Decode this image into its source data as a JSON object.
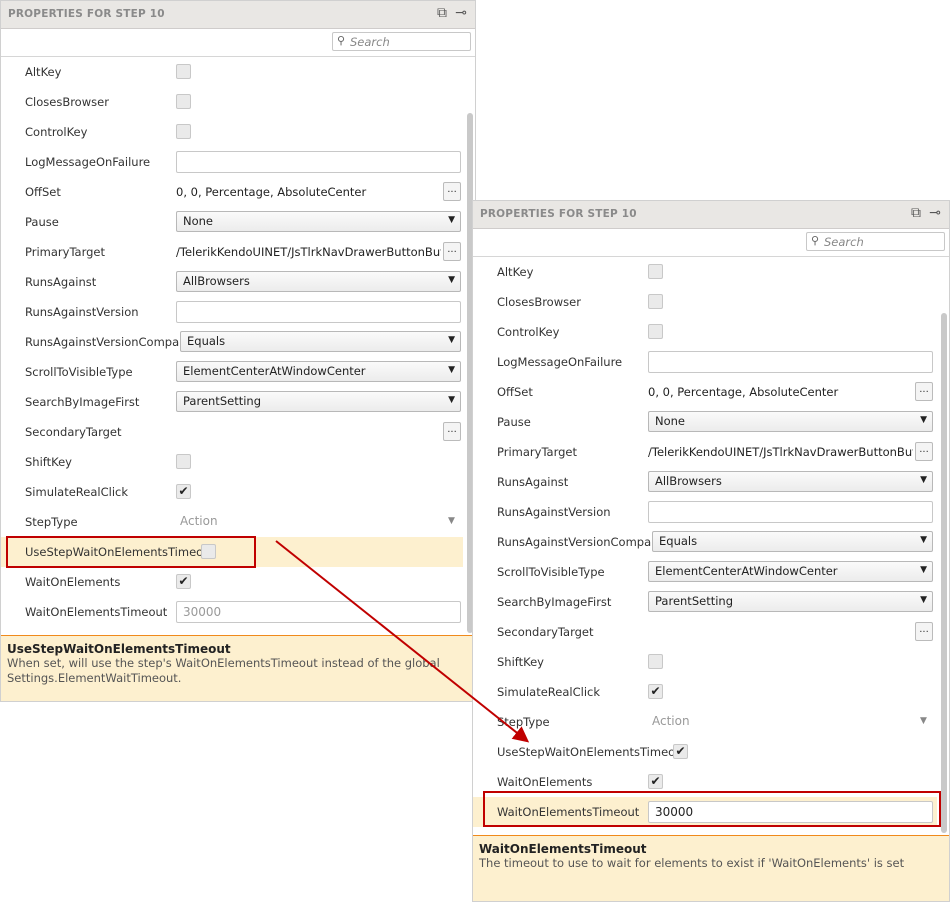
{
  "panels": [
    {
      "title": "PROPERTIES FOR STEP 10",
      "search_placeholder": "Search",
      "icons": [
        "pop-out-icon",
        "pin-icon"
      ],
      "rows": [
        {
          "label": "AltKey",
          "type": "checkbox",
          "checked": false
        },
        {
          "label": "ClosesBrowser",
          "type": "checkbox",
          "checked": false
        },
        {
          "label": "ControlKey",
          "type": "checkbox",
          "checked": false
        },
        {
          "label": "LogMessageOnFailure",
          "type": "text",
          "value": ""
        },
        {
          "label": "OffSet",
          "type": "value-ellipsis",
          "value": "0, 0, Percentage, AbsoluteCenter",
          "button": "..."
        },
        {
          "label": "Pause",
          "type": "select",
          "value": "None"
        },
        {
          "label": "PrimaryTarget",
          "type": "value-ellipsis",
          "value": "/TelerikKendoUINET/JsTlrkNavDrawerButtonButto",
          "button": "..."
        },
        {
          "label": "RunsAgainst",
          "type": "select",
          "value": "AllBrowsers"
        },
        {
          "label": "RunsAgainstVersion",
          "type": "text",
          "value": ""
        },
        {
          "label": "RunsAgainstVersionCompare",
          "type": "select",
          "value": "Equals"
        },
        {
          "label": "ScrollToVisibleType",
          "type": "select",
          "value": "ElementCenterAtWindowCenter"
        },
        {
          "label": "SearchByImageFirst",
          "type": "select",
          "value": "ParentSetting"
        },
        {
          "label": "SecondaryTarget",
          "type": "ellipsis",
          "button": "..."
        },
        {
          "label": "ShiftKey",
          "type": "checkbox",
          "checked": false
        },
        {
          "label": "SimulateRealClick",
          "type": "checkbox",
          "checked": true
        },
        {
          "label": "StepType",
          "type": "readonly",
          "value": "Action"
        },
        {
          "label": "UseStepWaitOnElementsTimeout",
          "type": "checkbox",
          "checked": false,
          "selected": true
        },
        {
          "label": "WaitOnElements",
          "type": "checkbox",
          "checked": true
        },
        {
          "label": "WaitOnElementsTimeout",
          "type": "text",
          "value": "30000",
          "disabled": true
        }
      ],
      "description": {
        "title": "UseStepWaitOnElementsTimeout",
        "text": "When set, will use the step's WaitOnElementsTimeout instead of the global Settings.ElementWaitTimeout."
      }
    },
    {
      "title": "PROPERTIES FOR STEP 10",
      "search_placeholder": "Search",
      "icons": [
        "pop-out-icon",
        "pin-icon"
      ],
      "rows": [
        {
          "label": "AltKey",
          "type": "checkbox",
          "checked": false
        },
        {
          "label": "ClosesBrowser",
          "type": "checkbox",
          "checked": false
        },
        {
          "label": "ControlKey",
          "type": "checkbox",
          "checked": false
        },
        {
          "label": "LogMessageOnFailure",
          "type": "text",
          "value": ""
        },
        {
          "label": "OffSet",
          "type": "value-ellipsis",
          "value": "0, 0, Percentage, AbsoluteCenter",
          "button": "..."
        },
        {
          "label": "Pause",
          "type": "select",
          "value": "None"
        },
        {
          "label": "PrimaryTarget",
          "type": "value-ellipsis",
          "value": "/TelerikKendoUINET/JsTlrkNavDrawerButtonButto",
          "button": "..."
        },
        {
          "label": "RunsAgainst",
          "type": "select",
          "value": "AllBrowsers"
        },
        {
          "label": "RunsAgainstVersion",
          "type": "text",
          "value": ""
        },
        {
          "label": "RunsAgainstVersionCompare",
          "type": "select",
          "value": "Equals"
        },
        {
          "label": "ScrollToVisibleType",
          "type": "select",
          "value": "ElementCenterAtWindowCenter"
        },
        {
          "label": "SearchByImageFirst",
          "type": "select",
          "value": "ParentSetting"
        },
        {
          "label": "SecondaryTarget",
          "type": "ellipsis",
          "button": "..."
        },
        {
          "label": "ShiftKey",
          "type": "checkbox",
          "checked": false
        },
        {
          "label": "SimulateRealClick",
          "type": "checkbox",
          "checked": true
        },
        {
          "label": "StepType",
          "type": "readonly",
          "value": "Action"
        },
        {
          "label": "UseStepWaitOnElementsTimeout",
          "type": "checkbox",
          "checked": true
        },
        {
          "label": "WaitOnElements",
          "type": "checkbox",
          "checked": true
        },
        {
          "label": "WaitOnElementsTimeout",
          "type": "text",
          "value": "30000",
          "selected": true
        }
      ],
      "description": {
        "title": "WaitOnElementsTimeout",
        "text": "The timeout to use to wait for elements to exist if 'WaitOnElements' is set"
      }
    }
  ],
  "annotation_color": "#c00000",
  "highlight_color": "#fdf0cf"
}
